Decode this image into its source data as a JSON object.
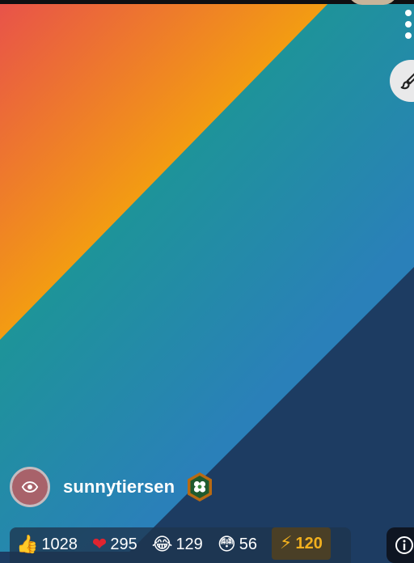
{
  "post": {
    "username": "sunnytiersen"
  },
  "reactions": [
    {
      "icon": "thumbs-up-icon",
      "emoji": "👍",
      "count": "1028"
    },
    {
      "icon": "heart-icon",
      "emoji": "❤",
      "count": "295"
    },
    {
      "icon": "laughing-icon",
      "emoji": "😂",
      "count": "129"
    },
    {
      "icon": "surprised-icon",
      "emoji": "😳",
      "count": "56"
    },
    {
      "icon": "lightning-icon",
      "emoji": "⚡",
      "count": "120"
    }
  ],
  "colors": {
    "gradient_red": "#e8524a",
    "gradient_orange": "#f39c12",
    "gradient_teal": "#16a085",
    "gradient_blue": "#2a80b9",
    "gradient_navy": "#1d3c62",
    "bolt_accent": "#f2b01e"
  }
}
